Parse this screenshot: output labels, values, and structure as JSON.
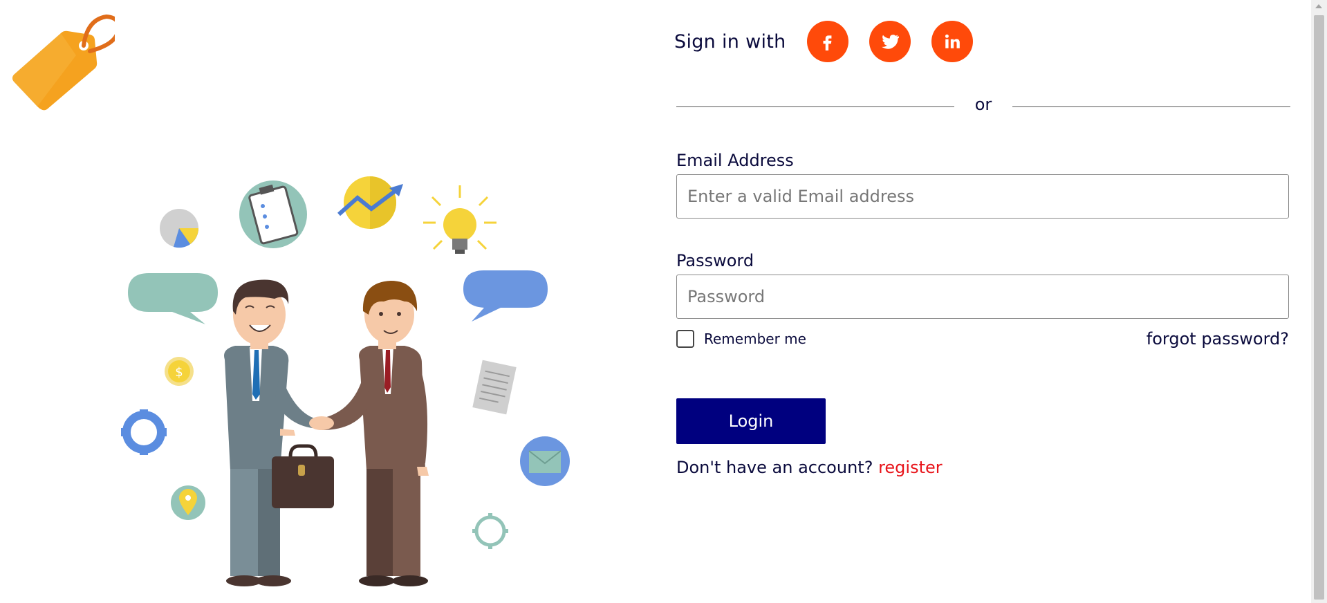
{
  "header": {
    "logo_icon": "price-tag-icon"
  },
  "signin": {
    "label": "Sign in with",
    "social": [
      {
        "name": "facebook",
        "icon": "facebook-icon"
      },
      {
        "name": "twitter",
        "icon": "twitter-icon"
      },
      {
        "name": "linkedin",
        "icon": "linkedin-icon"
      }
    ],
    "divider_text": "or"
  },
  "form": {
    "email": {
      "label": "Email Address",
      "placeholder": "Enter a valid Email address",
      "value": ""
    },
    "password": {
      "label": "Password",
      "placeholder": "Password",
      "value": ""
    },
    "remember_label": "Remember me",
    "remember_checked": false,
    "forgot_label": "forgot password?",
    "login_label": "Login",
    "register_prompt": "Don't have an account?",
    "register_link": "register"
  },
  "colors": {
    "social_button": "#ff4a0a",
    "login_button": "#00007f",
    "register_link": "#e8141a",
    "text": "#0a0a3c"
  }
}
